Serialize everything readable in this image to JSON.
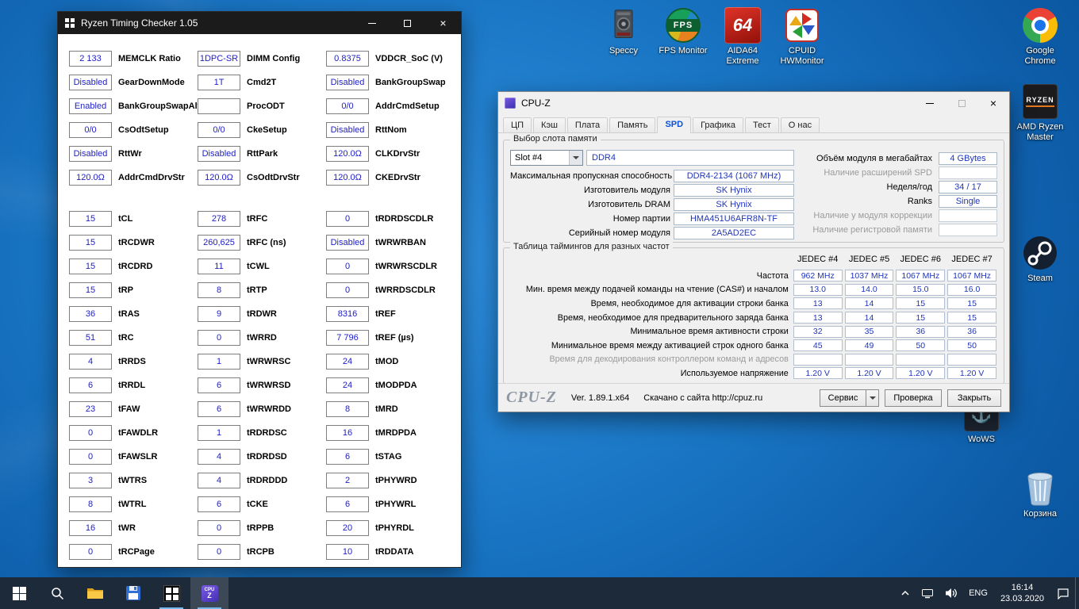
{
  "colors": {
    "accent_blue": "#2020c8",
    "cpuz_value_blue": "#1f35bb",
    "taskbar_bg": "#1d2a3a",
    "desktop_blue": "#1a77c6",
    "running_indicator": "#76b9ed"
  },
  "glyphs": {
    "close": "×",
    "anchor": "⚓"
  },
  "desktop": {
    "icons": [
      {
        "id": "speccy",
        "label": "Speccy"
      },
      {
        "id": "fps-monitor",
        "label": "FPS Monitor",
        "icon_text": "FPS"
      },
      {
        "id": "aida64-extreme",
        "label": "AIDA64\nExtreme",
        "icon_text": "64"
      },
      {
        "id": "cpuid-hwmonitor",
        "label": "CPUID\nHWMonitor"
      },
      {
        "id": "google-chrome",
        "label": "Google\nChrome"
      },
      {
        "id": "amd-ryzen-master",
        "label": "AMD Ryzen\nMaster",
        "icon_text": "RYZEN"
      },
      {
        "id": "steam",
        "label": "Steam"
      },
      {
        "id": "wows",
        "label": "WoWS",
        "icon_text": "⚓"
      },
      {
        "id": "recycle-bin",
        "label": "Корзина"
      }
    ]
  },
  "rtc_window": {
    "title": "Ryzen Timing Checker 1.05",
    "columns": [
      {
        "top": [
          {
            "v": "2 133",
            "l": "MEMCLK Ratio"
          },
          {
            "v": "Disabled",
            "l": "GearDownMode"
          },
          {
            "v": "Enabled",
            "l": "BankGroupSwapAlt"
          },
          {
            "v": "0/0",
            "l": "CsOdtSetup"
          },
          {
            "v": "Disabled",
            "l": "RttWr"
          },
          {
            "v": "120.0Ω",
            "l": "AddrCmdDrvStr"
          }
        ],
        "timings": [
          {
            "v": "15",
            "l": "tCL"
          },
          {
            "v": "15",
            "l": "tRCDWR"
          },
          {
            "v": "15",
            "l": "tRCDRD"
          },
          {
            "v": "15",
            "l": "tRP"
          },
          {
            "v": "36",
            "l": "tRAS"
          },
          {
            "v": "51",
            "l": "tRC"
          },
          {
            "v": "4",
            "l": "tRRDS"
          },
          {
            "v": "6",
            "l": "tRRDL"
          },
          {
            "v": "23",
            "l": "tFAW"
          },
          {
            "v": "0",
            "l": "tFAWDLR"
          },
          {
            "v": "0",
            "l": "tFAWSLR"
          },
          {
            "v": "3",
            "l": "tWTRS"
          },
          {
            "v": "8",
            "l": "tWTRL"
          },
          {
            "v": "16",
            "l": "tWR"
          },
          {
            "v": "0",
            "l": "tRCPage"
          }
        ]
      },
      {
        "top": [
          {
            "v": "1DPC-SR",
            "l": "DIMM Config"
          },
          {
            "v": "1T",
            "l": "Cmd2T"
          },
          {
            "v": "",
            "l": "ProcODT"
          },
          {
            "v": "0/0",
            "l": "CkeSetup"
          },
          {
            "v": "Disabled",
            "l": "RttPark"
          },
          {
            "v": "120.0Ω",
            "l": "CsOdtDrvStr"
          }
        ],
        "timings": [
          {
            "v": "278",
            "l": "tRFC"
          },
          {
            "v": "260,625",
            "l": "tRFC (ns)"
          },
          {
            "v": "11",
            "l": "tCWL"
          },
          {
            "v": "8",
            "l": "tRTP"
          },
          {
            "v": "9",
            "l": "tRDWR"
          },
          {
            "v": "0",
            "l": "tWRRD"
          },
          {
            "v": "1",
            "l": "tWRWRSC"
          },
          {
            "v": "6",
            "l": "tWRWRSD"
          },
          {
            "v": "6",
            "l": "tWRWRDD"
          },
          {
            "v": "1",
            "l": "tRDRDSC"
          },
          {
            "v": "4",
            "l": "tRDRDSD"
          },
          {
            "v": "4",
            "l": "tRDRDDD"
          },
          {
            "v": "6",
            "l": "tCKE"
          },
          {
            "v": "0",
            "l": "tRPPB"
          },
          {
            "v": "0",
            "l": "tRCPB"
          }
        ]
      },
      {
        "top": [
          {
            "v": "0.8375",
            "l": "VDDCR_SoC (V)"
          },
          {
            "v": "Disabled",
            "l": "BankGroupSwap"
          },
          {
            "v": "0/0",
            "l": "AddrCmdSetup"
          },
          {
            "v": "Disabled",
            "l": "RttNom"
          },
          {
            "v": "120.0Ω",
            "l": "CLKDrvStr"
          },
          {
            "v": "120.0Ω",
            "l": "CKEDrvStr"
          }
        ],
        "timings": [
          {
            "v": "0",
            "l": "tRDRDSCDLR"
          },
          {
            "v": "Disabled",
            "l": "tWRWRBAN"
          },
          {
            "v": "0",
            "l": "tWRWRSCDLR"
          },
          {
            "v": "0",
            "l": "tWRRDSCDLR"
          },
          {
            "v": "8316",
            "l": "tREF"
          },
          {
            "v": "7 796",
            "l": "tREF (µs)"
          },
          {
            "v": "24",
            "l": "tMOD"
          },
          {
            "v": "24",
            "l": "tMODPDA"
          },
          {
            "v": "8",
            "l": "tMRD"
          },
          {
            "v": "16",
            "l": "tMRDPDA"
          },
          {
            "v": "6",
            "l": "tSTAG"
          },
          {
            "v": "2",
            "l": "tPHYWRD"
          },
          {
            "v": "6",
            "l": "tPHYWRL"
          },
          {
            "v": "20",
            "l": "tPHYRDL"
          },
          {
            "v": "10",
            "l": "tRDDATA"
          }
        ]
      }
    ]
  },
  "cpuz_window": {
    "title": "CPU-Z",
    "tabs": [
      {
        "id": "cpu",
        "label": "ЦП"
      },
      {
        "id": "caches",
        "label": "Кэш"
      },
      {
        "id": "mainboard",
        "label": "Плата"
      },
      {
        "id": "memory",
        "label": "Память"
      },
      {
        "id": "spd",
        "label": "SPD"
      },
      {
        "id": "graphics",
        "label": "Графика"
      },
      {
        "id": "bench",
        "label": "Тест"
      },
      {
        "id": "about",
        "label": "О нас"
      }
    ],
    "active_tab": "spd",
    "slot_group": {
      "title": "Выбор слота памяти",
      "slot_select": "Slot #4",
      "memory_type": "DDR4",
      "left_rows": [
        {
          "label": "Максимальная пропускная способность",
          "value": "DDR4-2134 (1067 MHz)",
          "disabled": false
        },
        {
          "label": "Изготовитель модуля",
          "value": "SK Hynix",
          "disabled": false
        },
        {
          "label": "Изготовитель DRAM",
          "value": "SK Hynix",
          "disabled": false
        },
        {
          "label": "Номер партии",
          "value": "HMA451U6AFR8N-TF",
          "disabled": false
        },
        {
          "label": "Серийный номер модуля",
          "value": "2A5AD2EC",
          "disabled": false
        }
      ],
      "right_rows": [
        {
          "label": "Объём модуля в мегабайтах",
          "value": "4 GBytes",
          "disabled": false
        },
        {
          "label": "Наличие расширений SPD",
          "value": "",
          "disabled": true
        },
        {
          "label": "Неделя/год",
          "value": "34 / 17",
          "disabled": false
        },
        {
          "label": "Ranks",
          "value": "Single",
          "disabled": false
        },
        {
          "label": "Наличие у модуля коррекции",
          "value": "",
          "disabled": true
        },
        {
          "label": "Наличие регистровой памяти",
          "value": "",
          "disabled": true
        }
      ]
    },
    "timings_group": {
      "title": "Таблица таймингов для разных частот",
      "columns": [
        "JEDEC #4",
        "JEDEC #5",
        "JEDEC #6",
        "JEDEC #7"
      ],
      "rows": [
        {
          "label": "Частота",
          "values": [
            "962 MHz",
            "1037 MHz",
            "1067 MHz",
            "1067 MHz"
          ],
          "disabled": false
        },
        {
          "label": "Мин. время между подачей команды на чтение (CAS#) и началом",
          "values": [
            "13.0",
            "14.0",
            "15.0",
            "16.0"
          ],
          "disabled": false
        },
        {
          "label": "Время, необходимое для активации строки банка",
          "values": [
            "13",
            "14",
            "15",
            "15"
          ],
          "disabled": false
        },
        {
          "label": "Время, необходимое для предварительного заряда банка",
          "values": [
            "13",
            "14",
            "15",
            "15"
          ],
          "disabled": false
        },
        {
          "label": "Минимальное время активности строки",
          "values": [
            "32",
            "35",
            "36",
            "36"
          ],
          "disabled": false
        },
        {
          "label": "Минимальное время между активацией строк одного банка",
          "values": [
            "45",
            "49",
            "50",
            "50"
          ],
          "disabled": false
        },
        {
          "label": "Время для декодирования контроллером команд и адресов",
          "values": [
            "",
            "",
            "",
            ""
          ],
          "disabled": true
        },
        {
          "label": "Используемое напряжение",
          "values": [
            "1.20 V",
            "1.20 V",
            "1.20 V",
            "1.20 V"
          ],
          "disabled": false
        }
      ]
    },
    "footer": {
      "logo": "CPU-Z",
      "version": "Ver. 1.89.1.x64",
      "site": "Скачано с сайта http://cpuz.ru",
      "buttons": {
        "service": "Сервис",
        "check": "Проверка",
        "close": "Закрыть"
      }
    }
  },
  "taskbar": {
    "cpuz_icon_line1": "CPU",
    "cpuz_icon_line2": "Z",
    "tray": {
      "language": "ENG",
      "time": "16:14",
      "date": "23.03.2020"
    }
  }
}
